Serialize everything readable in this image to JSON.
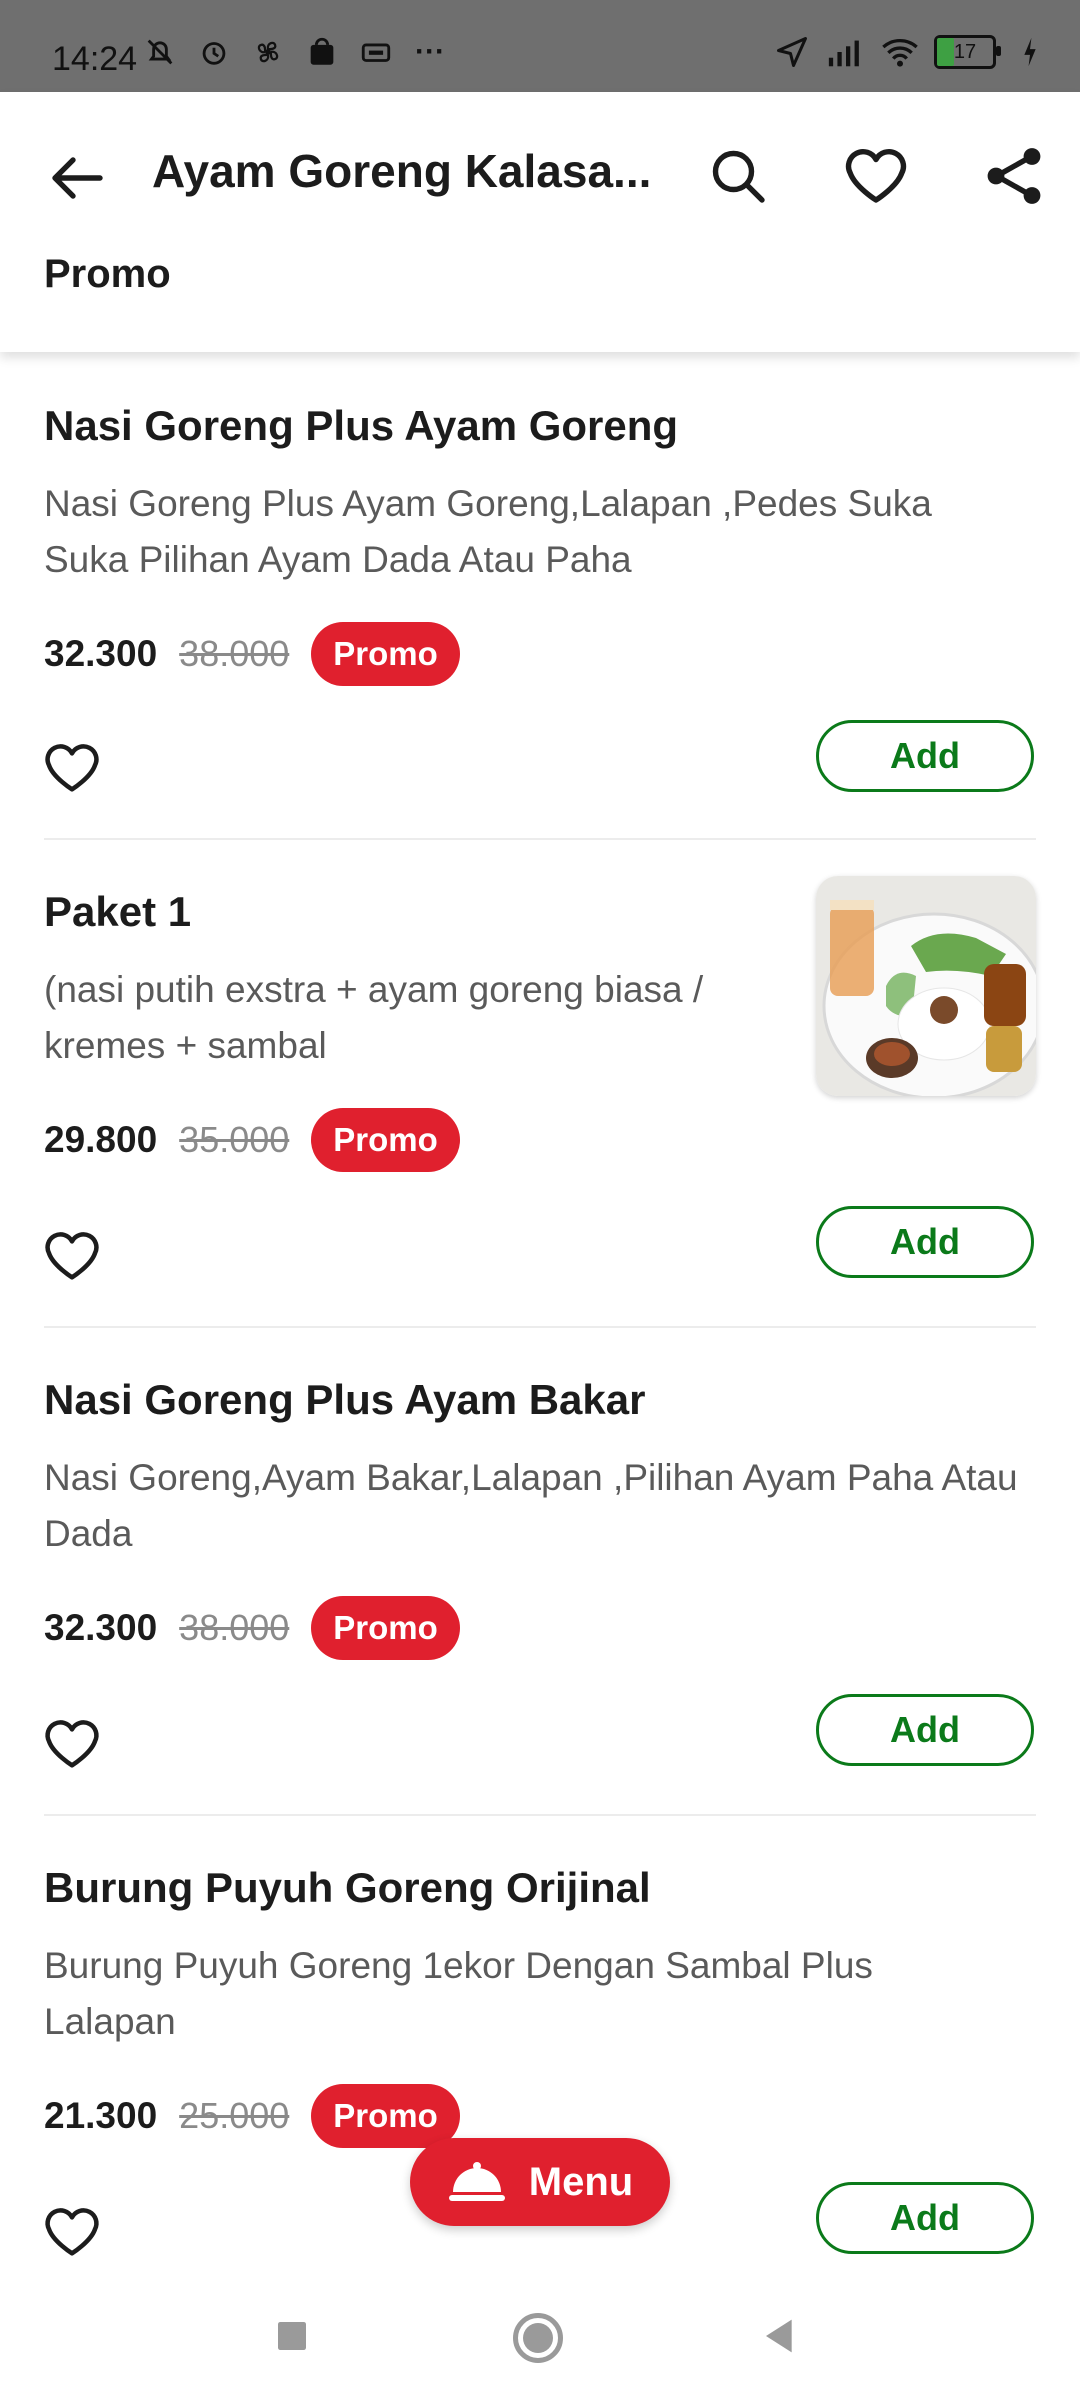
{
  "status_bar": {
    "time": "14:24",
    "battery": "17",
    "more": "···"
  },
  "header": {
    "title": "Ayam Goreng Kalasa...",
    "section": "Promo"
  },
  "items": [
    {
      "name": "Nasi Goreng Plus Ayam Goreng",
      "description": "Nasi Goreng Plus Ayam Goreng,Lalapan ,Pedes Suka Suka Pilihan  Ayam Dada Atau  Paha",
      "price": "32.300",
      "original_price": "38.000",
      "badge": "Promo",
      "add_label": "Add"
    },
    {
      "name": "Paket 1",
      "description": "(nasi putih exstra + ayam goreng biasa / kremes + sambal",
      "price": "29.800",
      "original_price": "35.000",
      "badge": "Promo",
      "add_label": "Add"
    },
    {
      "name": "Nasi Goreng Plus Ayam Bakar",
      "description": "Nasi Goreng,Ayam Bakar,Lalapan ,Pilihan Ayam Paha Atau Dada",
      "price": "32.300",
      "original_price": "38.000",
      "badge": "Promo",
      "add_label": "Add"
    },
    {
      "name": "Burung Puyuh Goreng Orijinal",
      "description": "Burung Puyuh Goreng 1ekor Dengan  Sambal Plus Lalapan",
      "price": "21.300",
      "original_price": "25.000",
      "badge": "Promo",
      "add_label": "Add"
    }
  ],
  "menu_button": {
    "label": "Menu"
  },
  "colors": {
    "promo_red": "#e0202e",
    "add_green": "#0b7a1a",
    "status_bar": "#6f6f6f"
  }
}
